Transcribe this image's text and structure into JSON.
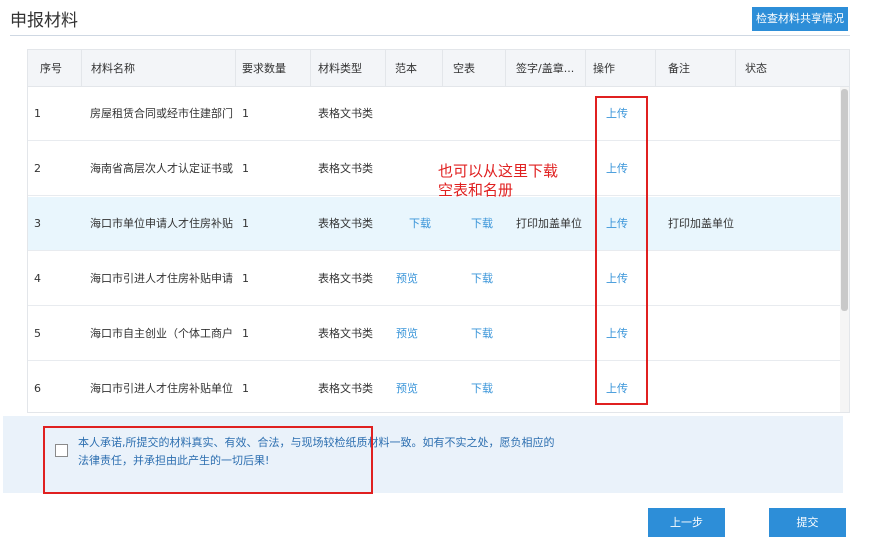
{
  "header": {
    "title": "申报材料",
    "check_share_label": "检查材料共享情况"
  },
  "table": {
    "columns": [
      "序号",
      "材料名称",
      "要求数量",
      "材料类型",
      "范本",
      "空表",
      "签字/盖章...",
      "操作",
      "备注",
      "状态"
    ],
    "rows": [
      {
        "no": "1",
        "name": "房屋租赁合同或经市住建部门",
        "qty": "1",
        "type": "表格文书类",
        "sample": "",
        "blank": "",
        "sign": "",
        "action": "上传",
        "remark": "",
        "status": ""
      },
      {
        "no": "2",
        "name": "海南省高层次人才认定证书或",
        "qty": "1",
        "type": "表格文书类",
        "sample": "",
        "blank": "",
        "sign": "",
        "action": "上传",
        "remark": "",
        "status": ""
      },
      {
        "no": "3",
        "name": "海口市单位申请人才住房补贴",
        "qty": "1",
        "type": "表格文书类",
        "sample": "下载",
        "blank": "下载",
        "sign": "打印加盖单位",
        "action": "上传",
        "remark": "打印加盖单位",
        "status": ""
      },
      {
        "no": "4",
        "name": "海口市引进人才住房补贴申请",
        "qty": "1",
        "type": "表格文书类",
        "sample": "预览",
        "blank": "下载",
        "sign": "",
        "action": "上传",
        "remark": "",
        "status": ""
      },
      {
        "no": "5",
        "name": "海口市自主创业（个体工商户",
        "qty": "1",
        "type": "表格文书类",
        "sample": "预览",
        "blank": "下载",
        "sign": "",
        "action": "上传",
        "remark": "",
        "status": ""
      },
      {
        "no": "6",
        "name": "海口市引进人才住房补贴单位",
        "qty": "1",
        "type": "表格文书类",
        "sample": "预览",
        "blank": "下载",
        "sign": "",
        "action": "上传",
        "remark": "",
        "status": ""
      }
    ]
  },
  "annotation": {
    "line1": "也可以从这里下载",
    "line2": "空表和名册"
  },
  "pledge": {
    "text": "本人承诺,所提交的材料真实、有效、合法，与现场较检纸质材料一致。如有不实之处，愿负相应的法律责任，并承担由此产生的一切后果!"
  },
  "buttons": {
    "prev_label": "上一步",
    "submit_label": "提交"
  },
  "colors": {
    "primary": "#2d8ed8",
    "link": "#3a95d9",
    "annotation_red": "#e02020",
    "highlight_row": "#e9f6fd"
  }
}
